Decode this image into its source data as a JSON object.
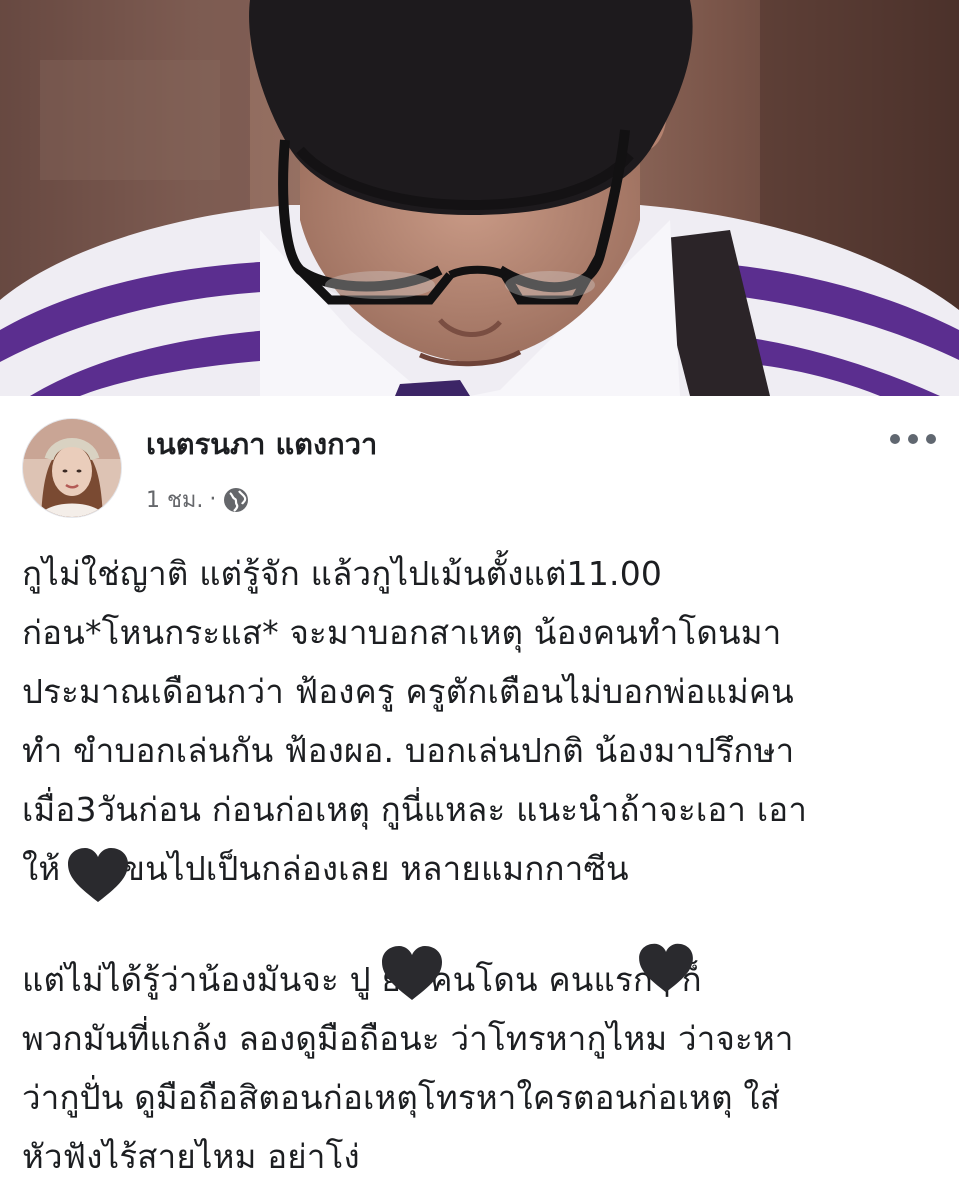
{
  "post": {
    "author_name": "เนตรนภา แตงกวา",
    "time": "1 ชม.",
    "separator": "·",
    "privacy_icon": "globe-icon",
    "more_icon": "more-options-icon",
    "avatar_icon": "profile-avatar",
    "paragraph1": [
      "กูไม่ใช่ญาติ แต่รู้จัก แล้วกูไปเม้นตั้งแต่11.00",
      "ก่อน*โหนกระแส* จะมาบอกสาเหตุ น้องคนทำโดนมา",
      "ประมาณเดือนกว่า ฟ้องครู ครูตักเตือนไม่บอกพ่อแม่คน",
      "ทำ ขำบอกเล่นกัน ฟ้องผอ. บอกเล่นปกติ น้องมาปรึกษา",
      "เมื่อ3วันก่อน ก่อนก่อเหตุ กูนี่แหละ แนะนำถ้าจะเอา เอา",
      "ให้        เลยขนไปเป็นกล่องเลย หลายแมกกาซีน"
    ],
    "paragraph2": [
      "แต่ไม่ได้รู้ว่าน้องมันจะ        ปู ย่า คนโดน    คนแรกๆ ก็",
      "พวกมันที่แกล้ง ลองดูมือถือนะ ว่าโทรหากูไหม ว่าจะหา",
      "ว่ากูปั่น ดูมือถือสิตอนก่อเหตุโทรหาใครตอนก่อเหตุ ใส่",
      "หัวฟังไร้สายไหม อย่าโง่"
    ],
    "redaction_icon": "black-heart-icon"
  },
  "colors": {
    "text": "#1c1e21",
    "meta": "#65676b",
    "heart": "#2a2a2e",
    "uniform_purple": "#5b2e8f"
  }
}
